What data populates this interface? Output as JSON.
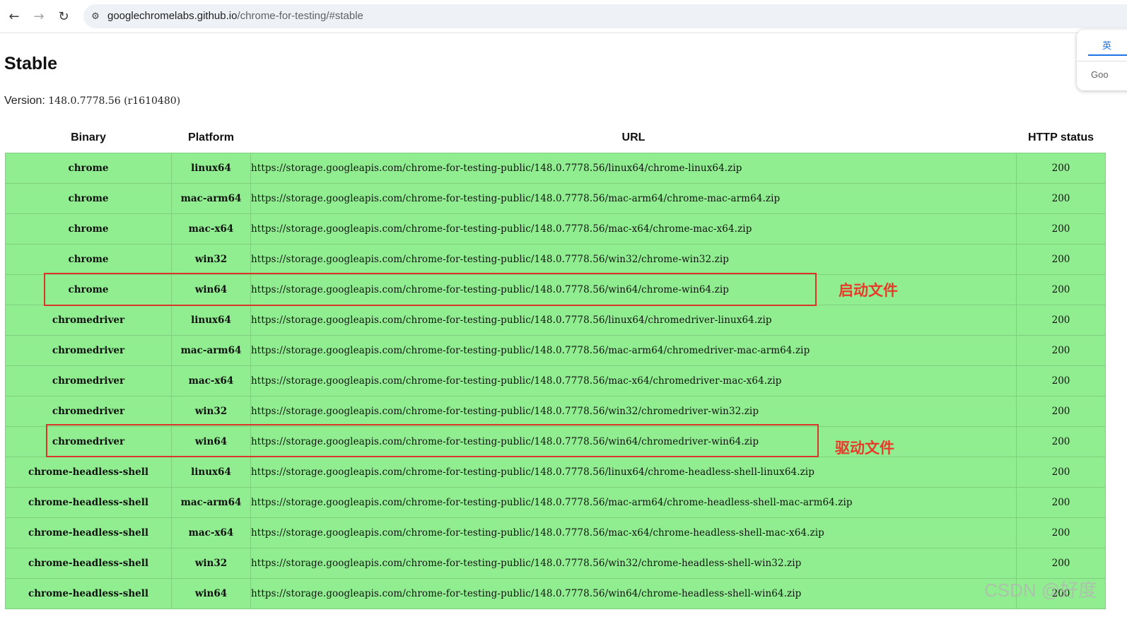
{
  "browser": {
    "url_host": "googlechromelabs.github.io",
    "url_path": "/chrome-for-testing/#stable",
    "icons": {
      "back": "back-arrow-icon",
      "forward": "forward-arrow-icon",
      "reload": "reload-icon",
      "site_info": "site-info-icon"
    }
  },
  "translate_popup": {
    "tab_label": "英",
    "footer_text": "Goo"
  },
  "page": {
    "heading": "Stable",
    "version_label": "Version: ",
    "version_value": "148.0.7778.56 (r1610480)"
  },
  "table": {
    "headers": [
      "Binary",
      "Platform",
      "URL",
      "HTTP status"
    ],
    "rows": [
      {
        "binary": "chrome",
        "platform": "linux64",
        "url": "https://storage.googleapis.com/chrome-for-testing-public/148.0.7778.56/linux64/chrome-linux64.zip",
        "status": "200"
      },
      {
        "binary": "chrome",
        "platform": "mac-arm64",
        "url": "https://storage.googleapis.com/chrome-for-testing-public/148.0.7778.56/mac-arm64/chrome-mac-arm64.zip",
        "status": "200"
      },
      {
        "binary": "chrome",
        "platform": "mac-x64",
        "url": "https://storage.googleapis.com/chrome-for-testing-public/148.0.7778.56/mac-x64/chrome-mac-x64.zip",
        "status": "200"
      },
      {
        "binary": "chrome",
        "platform": "win32",
        "url": "https://storage.googleapis.com/chrome-for-testing-public/148.0.7778.56/win32/chrome-win32.zip",
        "status": "200"
      },
      {
        "binary": "chrome",
        "platform": "win64",
        "url": "https://storage.googleapis.com/chrome-for-testing-public/148.0.7778.56/win64/chrome-win64.zip",
        "status": "200"
      },
      {
        "binary": "chromedriver",
        "platform": "linux64",
        "url": "https://storage.googleapis.com/chrome-for-testing-public/148.0.7778.56/linux64/chromedriver-linux64.zip",
        "status": "200"
      },
      {
        "binary": "chromedriver",
        "platform": "mac-arm64",
        "url": "https://storage.googleapis.com/chrome-for-testing-public/148.0.7778.56/mac-arm64/chromedriver-mac-arm64.zip",
        "status": "200"
      },
      {
        "binary": "chromedriver",
        "platform": "mac-x64",
        "url": "https://storage.googleapis.com/chrome-for-testing-public/148.0.7778.56/mac-x64/chromedriver-mac-x64.zip",
        "status": "200"
      },
      {
        "binary": "chromedriver",
        "platform": "win32",
        "url": "https://storage.googleapis.com/chrome-for-testing-public/148.0.7778.56/win32/chromedriver-win32.zip",
        "status": "200"
      },
      {
        "binary": "chromedriver",
        "platform": "win64",
        "url": "https://storage.googleapis.com/chrome-for-testing-public/148.0.7778.56/win64/chromedriver-win64.zip",
        "status": "200"
      },
      {
        "binary": "chrome-headless-shell",
        "platform": "linux64",
        "url": "https://storage.googleapis.com/chrome-for-testing-public/148.0.7778.56/linux64/chrome-headless-shell-linux64.zip",
        "status": "200"
      },
      {
        "binary": "chrome-headless-shell",
        "platform": "mac-arm64",
        "url": "https://storage.googleapis.com/chrome-for-testing-public/148.0.7778.56/mac-arm64/chrome-headless-shell-mac-arm64.zip",
        "status": "200"
      },
      {
        "binary": "chrome-headless-shell",
        "platform": "mac-x64",
        "url": "https://storage.googleapis.com/chrome-for-testing-public/148.0.7778.56/mac-x64/chrome-headless-shell-mac-x64.zip",
        "status": "200"
      },
      {
        "binary": "chrome-headless-shell",
        "platform": "win32",
        "url": "https://storage.googleapis.com/chrome-for-testing-public/148.0.7778.56/win32/chrome-headless-shell-win32.zip",
        "status": "200"
      },
      {
        "binary": "chrome-headless-shell",
        "platform": "win64",
        "url": "https://storage.googleapis.com/chrome-for-testing-public/148.0.7778.56/win64/chrome-headless-shell-win64.zip",
        "status": "200"
      }
    ]
  },
  "annotations": {
    "launch_label": "启动文件",
    "driver_label": "驱动文件",
    "color": "#e83a2a"
  },
  "watermark": "CSDN @好度"
}
